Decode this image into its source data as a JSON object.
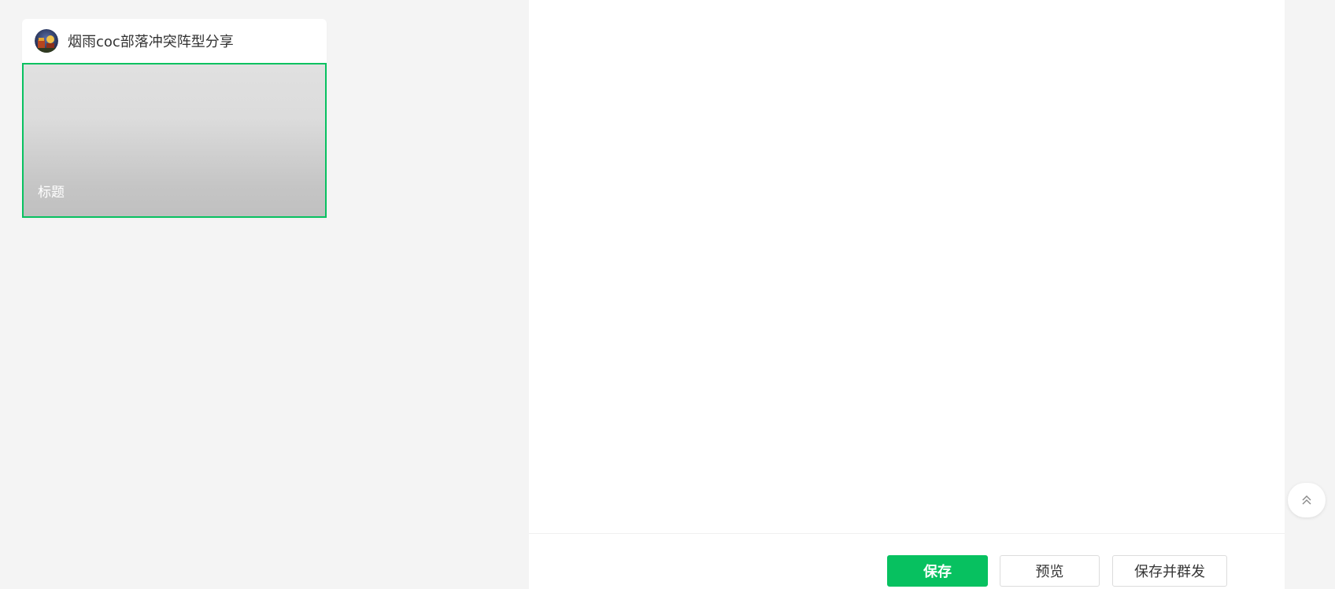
{
  "account": {
    "name": "烟雨coc部落冲突阵型分享",
    "avatar_icon": "clan-avatar-icon"
  },
  "article": {
    "cover_title": "标题"
  },
  "footer": {
    "save_label": "保存",
    "preview_label": "预览",
    "publish_label": "保存并群发"
  },
  "back_to_top": {
    "icon": "double-chevron-up-icon"
  },
  "colors": {
    "page_bg": "#f4f4f4",
    "primary": "#07c160",
    "card_bg": "#ffffff"
  }
}
